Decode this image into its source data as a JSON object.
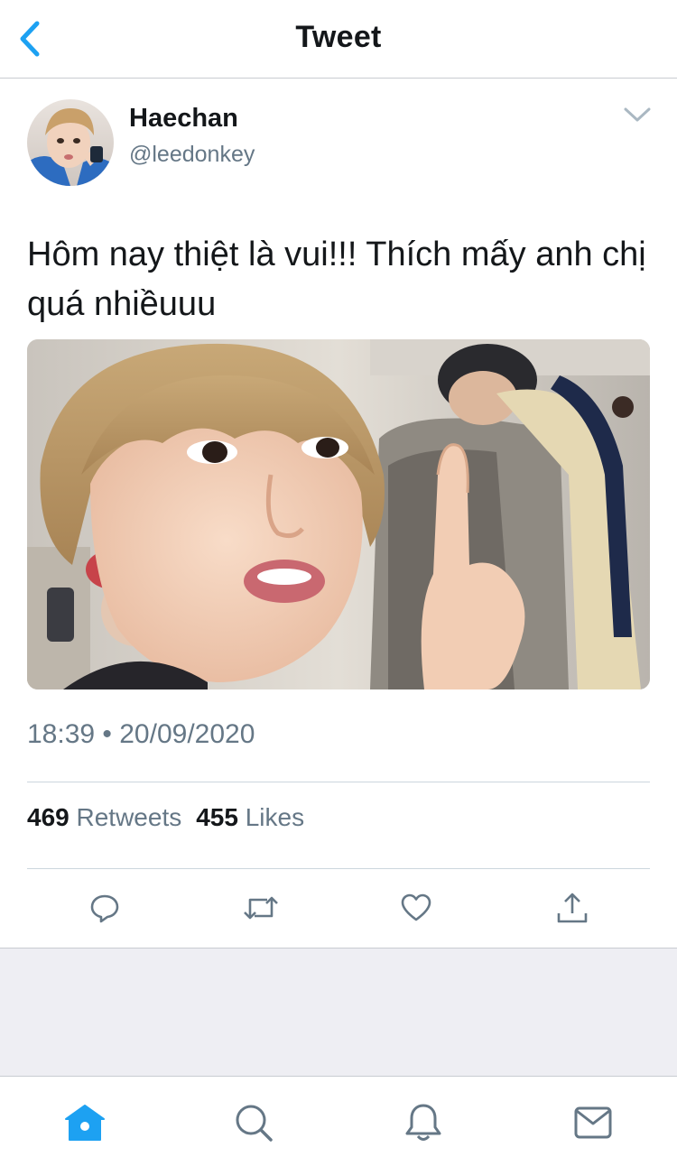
{
  "nav": {
    "title": "Tweet",
    "back_icon": "chevron-left-icon"
  },
  "tweet": {
    "author": {
      "name": "Haechan",
      "handle": "@leedonkey"
    },
    "text": "Hôm nay thiệt là vui!!! Thích mấy anh chị quá nhiềuuu",
    "timestamp": "18:39 • 20/09/2020",
    "stats": {
      "retweets_count": "469",
      "retweets_label": "Retweets",
      "likes_count": "455",
      "likes_label": "Likes"
    },
    "actions": [
      "reply-icon",
      "retweet-icon",
      "like-icon",
      "share-icon"
    ]
  },
  "tabs": [
    "home-icon",
    "search-icon",
    "notifications-icon",
    "messages-icon"
  ],
  "colors": {
    "accent": "#1da1f2",
    "secondary_text": "#657786",
    "divider": "#ccd6dd",
    "footer_bg": "#eeeef3"
  }
}
